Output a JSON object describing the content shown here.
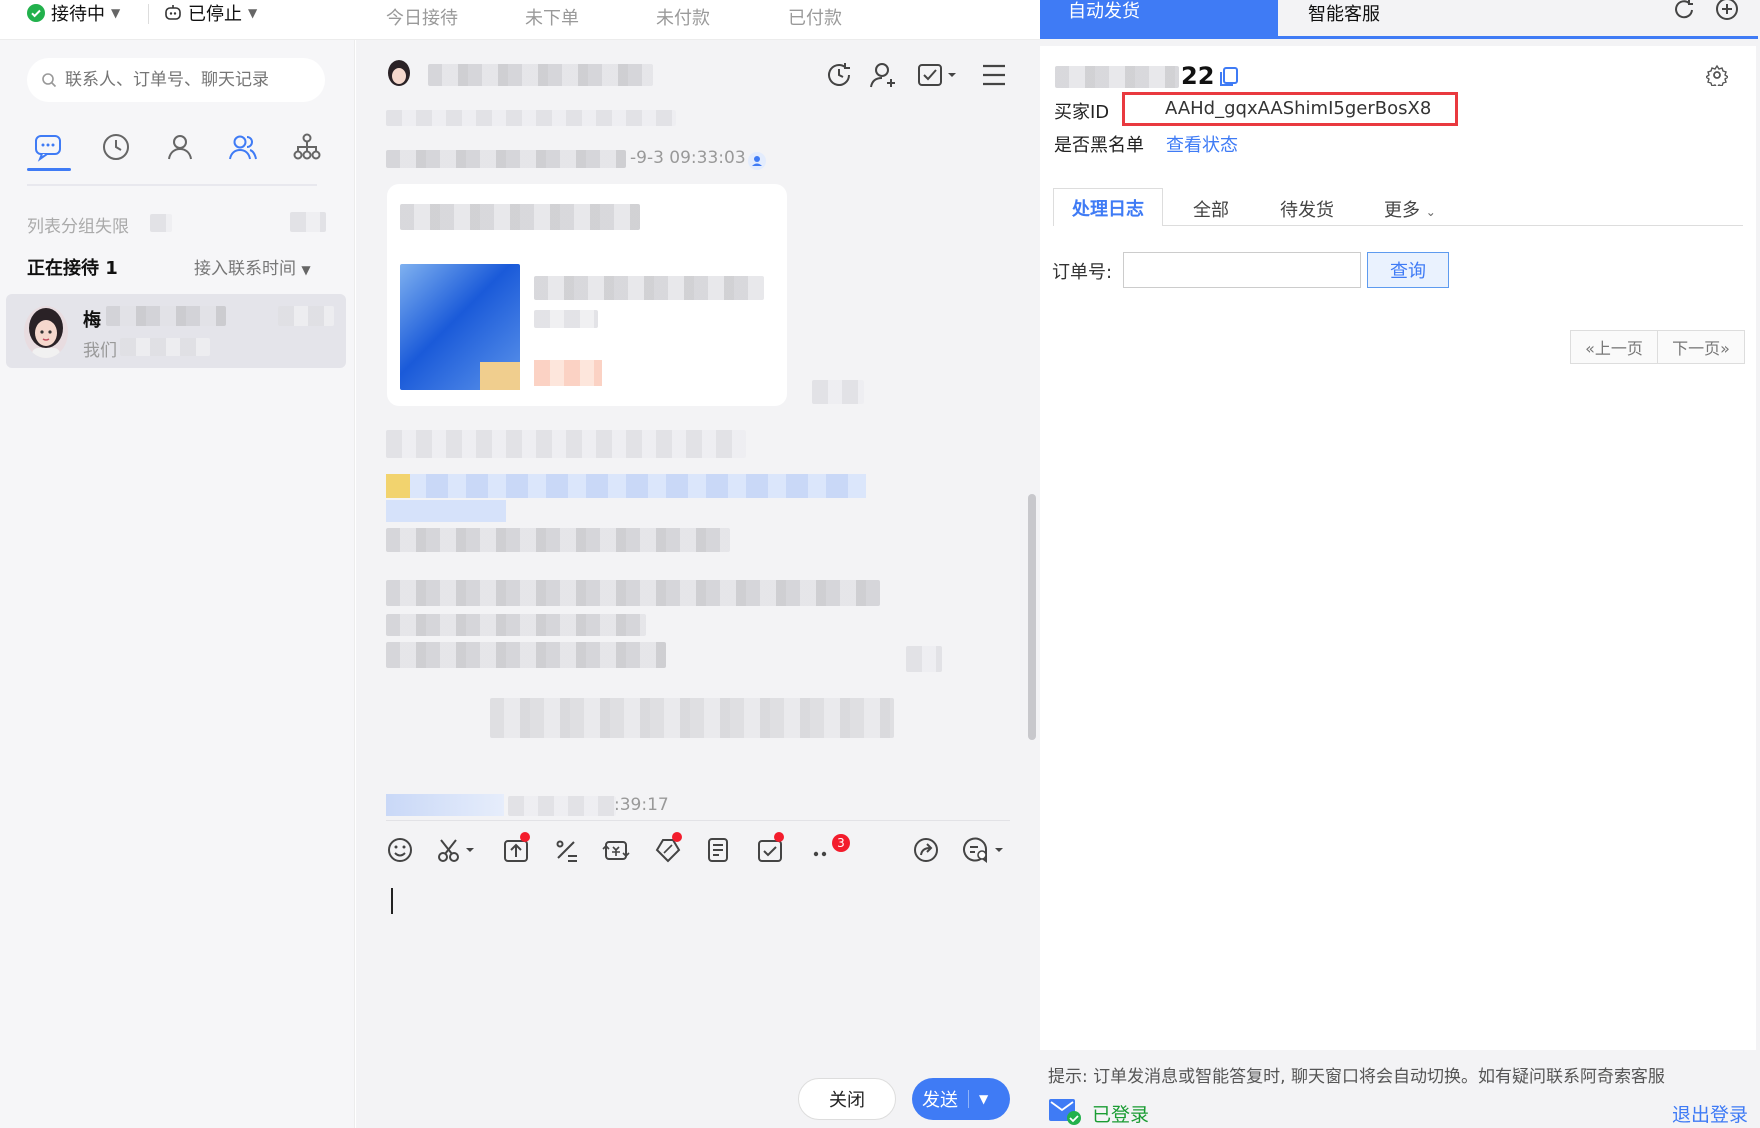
{
  "topbar": {
    "status_receiving": "接待中",
    "status_stopped": "已停止",
    "tabs": [
      "今日接待",
      "未下单",
      "未付款",
      "已付款"
    ]
  },
  "left": {
    "search_placeholder": "联系人、订单号、聊天记录",
    "group_label": "列表分组失限",
    "serving_label": "正在接待 1",
    "sort_label": "接入联系时间",
    "contact_name": "梅",
    "contact_preview": "我们"
  },
  "chat": {
    "msg_time": "-9-3 09:33:03",
    "bottom_time": ":39:17",
    "badge_count": "3",
    "close_label": "关闭",
    "send_label": "发送"
  },
  "right": {
    "tab_auto": "自动发货",
    "tab_smart": "智能客服",
    "buyer_suffix": "22",
    "buyer_id_label": "买家ID",
    "buyer_id": "AAHd_gqxAAShimI5gerBosX8",
    "blacklist_label": "是否黑名单",
    "check_status": "查看状态",
    "sub_tabs": [
      "处理日志",
      "全部",
      "待发货",
      "更多"
    ],
    "order_label": "订单号:",
    "query_label": "查询",
    "prev_page": "«上一页",
    "next_page": "下一页»",
    "tip": "提示: 订单发消息或智能答复时, 聊天窗口将会自动切换。如有疑问联系阿奇索客服",
    "logged_in": "已登录",
    "logout": "退出登录"
  },
  "colors": {
    "accent": "#3f7bf5",
    "alert": "#e9393f",
    "online": "#1a9c33"
  }
}
